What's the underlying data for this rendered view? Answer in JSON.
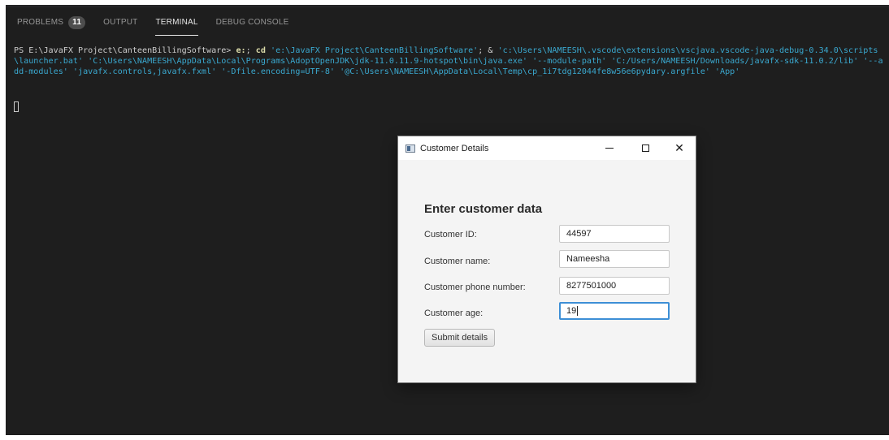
{
  "panel": {
    "tabs": [
      {
        "label": "PROBLEMS",
        "badge": "11"
      },
      {
        "label": "OUTPUT"
      },
      {
        "label": "TERMINAL"
      },
      {
        "label": "DEBUG CONSOLE"
      }
    ],
    "active_tab": "TERMINAL"
  },
  "terminal": {
    "prompt": "PS E:\\JavaFX Project\\CanteenBillingSoftware> ",
    "cmd1": "e:",
    "sep1": "; ",
    "cmd2": "cd",
    "sp1": " ",
    "path1": "'e:\\JavaFX Project\\CanteenBillingSoftware'",
    "sep2": "; & ",
    "args": "'c:\\Users\\NAMEESH\\.vscode\\extensions\\vscjava.vscode-java-debug-0.34.0\\scripts\\launcher.bat' 'C:\\Users\\NAMEESH\\AppData\\Local\\Programs\\AdoptOpenJDK\\jdk-11.0.11.9-hotspot\\bin\\java.exe' '--module-path' 'C:/Users/NAMEESH/Downloads/javafx-sdk-11.0.2/lib' '--add-modules' 'javafx.controls,javafx.fxml' '-Dfile.encoding=UTF-8' '@C:\\Users\\NAMEESH\\AppData\\Local\\Temp\\cp_1i7tdg12044fe8w56e6pydary.argfile' 'App'"
  },
  "dialog": {
    "title": "Customer Details",
    "heading": "Enter customer data",
    "fields": [
      {
        "label": "Customer ID:",
        "value": "44597"
      },
      {
        "label": "Customer name:",
        "value": "Nameesha"
      },
      {
        "label": "Customer phone number:",
        "value": "8277501000"
      },
      {
        "label": "Customer age:",
        "value": "19"
      }
    ],
    "submit_label": "Submit details",
    "icons": {
      "app": "java-window-icon",
      "minimize": "minimize-icon",
      "maximize": "maximize-icon",
      "close": "close-icon"
    },
    "colors": {
      "focus": "#3d8fd6"
    }
  },
  "colors": {
    "terminal_bg": "#1e1e1e",
    "string": "#3aa8cf",
    "command": "#dcdcaa"
  }
}
